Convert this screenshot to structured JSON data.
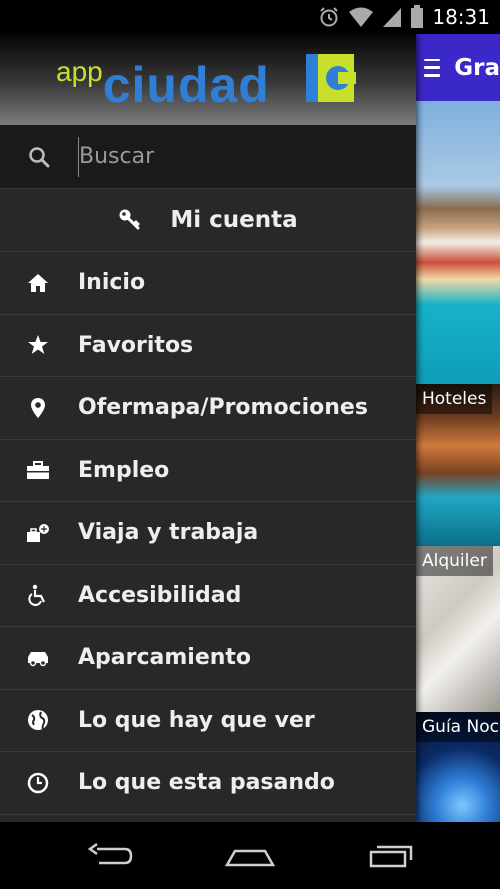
{
  "status_bar": {
    "time": "18:31",
    "icons": [
      "alarm-icon",
      "wifi-icon",
      "signal-icon",
      "battery-icon"
    ]
  },
  "drawer": {
    "logo": {
      "app": "app",
      "ciudad": "ciudad"
    },
    "search": {
      "placeholder": "Buscar",
      "value": ""
    },
    "account": {
      "label": "Mi cuenta",
      "icon": "key-icon"
    },
    "items": [
      {
        "label": "Inicio",
        "icon": "home-icon"
      },
      {
        "label": "Favoritos",
        "icon": "star-icon"
      },
      {
        "label": "Ofermapa/Promociones",
        "icon": "map-pin-icon"
      },
      {
        "label": "Empleo",
        "icon": "briefcase-icon"
      },
      {
        "label": "Viaja y trabaja",
        "icon": "travel-work-icon"
      },
      {
        "label": "Accesibilidad",
        "icon": "wheelchair-icon"
      },
      {
        "label": "Aparcamiento",
        "icon": "car-icon"
      },
      {
        "label": "Lo que hay que ver",
        "icon": "globe-icon"
      },
      {
        "label": "Lo que esta pasando",
        "icon": "clock-icon"
      }
    ]
  },
  "content": {
    "title": "Gra",
    "tiles": [
      "Hoteles",
      "Alquiler",
      "Guía Noc"
    ]
  },
  "colors": {
    "drawer_bg": "#282828",
    "app_bar": "#3b28c8",
    "logo_blue": "#2f7fd6",
    "logo_green": "#c8e02b"
  }
}
